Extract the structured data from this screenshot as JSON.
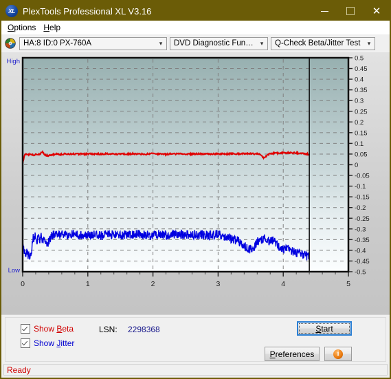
{
  "window": {
    "title": "PlexTools Professional XL V3.16",
    "app_icon": "xl-disc-icon",
    "minimize_label": "",
    "maximize_label": "",
    "close_label": "✕"
  },
  "menubar": {
    "items": [
      {
        "mnemonic": "O",
        "rest": "ptions"
      },
      {
        "mnemonic": "H",
        "rest": "elp"
      }
    ]
  },
  "toolbar": {
    "disc_icon": "optical-disc-icon",
    "drive": {
      "value": "HA:8 ID:0  PX-760A",
      "arrow": "⌄"
    },
    "function": {
      "value": "DVD Diagnostic Functions",
      "arrow": "⌄"
    },
    "test": {
      "value": "Q-Check Beta/Jitter Test",
      "arrow": "⌄"
    }
  },
  "chart_data": {
    "type": "line",
    "title": "",
    "xlabel": "",
    "ylabel": "",
    "xlim": [
      0,
      5
    ],
    "ylim": [
      -0.5,
      0.5
    ],
    "grid": true,
    "legend_position": "bottom-left",
    "y_tick_labels": [
      "0.5",
      "0.45",
      "0.4",
      "0.35",
      "0.3",
      "0.25",
      "0.2",
      "0.15",
      "0.1",
      "0.05",
      "0",
      "-0.05",
      "-0.1",
      "-0.15",
      "-0.2",
      "-0.25",
      "-0.3",
      "-0.35",
      "-0.4",
      "-0.45",
      "-0.5"
    ],
    "x_tick_labels": [
      "0",
      "1",
      "2",
      "3",
      "4",
      "5"
    ],
    "axis_end_labels": {
      "top": "High",
      "bottom": "Low"
    },
    "cursor_x": 4.4,
    "data_end_x": 4.4,
    "colors": {
      "beta": "#e00000",
      "jitter": "#0000e0",
      "plot_top": "#9ab2b2",
      "plot_bottom": "#fbfdfd"
    },
    "series": [
      {
        "name": "Beta",
        "color": "#e00000",
        "x": [
          0.0,
          0.03,
          0.06,
          0.09,
          0.12,
          0.15,
          0.18,
          0.21,
          0.24,
          0.27,
          0.3,
          0.33,
          0.36,
          0.39,
          0.42,
          0.45,
          0.48,
          0.51,
          0.54,
          0.57,
          0.6,
          0.65,
          0.7,
          0.75,
          0.8,
          0.85,
          0.9,
          0.95,
          1.0,
          1.1,
          1.2,
          1.3,
          1.4,
          1.5,
          1.6,
          1.7,
          1.8,
          1.9,
          2.0,
          2.1,
          2.2,
          2.3,
          2.4,
          2.5,
          2.6,
          2.7,
          2.8,
          2.9,
          3.0,
          3.1,
          3.2,
          3.3,
          3.4,
          3.5,
          3.55,
          3.6,
          3.65,
          3.7,
          3.75,
          3.8,
          3.85,
          3.9,
          3.95,
          4.0,
          4.1,
          4.2,
          4.3,
          4.4
        ],
        "y": [
          0.005,
          0.047,
          0.049,
          0.046,
          0.051,
          0.048,
          0.045,
          0.05,
          0.047,
          0.052,
          0.062,
          0.05,
          0.044,
          0.041,
          0.044,
          0.047,
          0.048,
          0.052,
          0.05,
          0.048,
          0.05,
          0.05,
          0.05,
          0.051,
          0.049,
          0.05,
          0.051,
          0.05,
          0.05,
          0.05,
          0.05,
          0.051,
          0.05,
          0.049,
          0.05,
          0.052,
          0.05,
          0.05,
          0.054,
          0.05,
          0.049,
          0.051,
          0.05,
          0.05,
          0.05,
          0.051,
          0.05,
          0.05,
          0.051,
          0.05,
          0.051,
          0.051,
          0.052,
          0.052,
          0.051,
          0.052,
          0.048,
          0.03,
          0.043,
          0.051,
          0.054,
          0.055,
          0.055,
          0.056,
          0.056,
          0.055,
          0.053,
          0.048
        ]
      },
      {
        "name": "Jitter",
        "color": "#0000e0",
        "x": [
          0.0,
          0.02,
          0.04,
          0.06,
          0.08,
          0.1,
          0.12,
          0.14,
          0.16,
          0.18,
          0.2,
          0.22,
          0.24,
          0.26,
          0.28,
          0.3,
          0.32,
          0.34,
          0.36,
          0.38,
          0.4,
          0.45,
          0.5,
          0.55,
          0.6,
          0.7,
          0.8,
          0.9,
          1.0,
          1.1,
          1.2,
          1.3,
          1.4,
          1.5,
          1.6,
          1.7,
          1.8,
          1.9,
          2.0,
          2.1,
          2.2,
          2.3,
          2.4,
          2.5,
          2.6,
          2.7,
          2.8,
          2.9,
          3.0,
          3.05,
          3.1,
          3.15,
          3.2,
          3.25,
          3.3,
          3.35,
          3.4,
          3.45,
          3.5,
          3.55,
          3.6,
          3.65,
          3.7,
          3.75,
          3.8,
          3.85,
          3.9,
          3.95,
          4.0,
          4.05,
          4.1,
          4.15,
          4.2,
          4.25,
          4.3,
          4.35,
          4.4
        ],
        "y": [
          -0.37,
          -0.4,
          -0.415,
          -0.405,
          -0.425,
          -0.43,
          -0.42,
          -0.4,
          -0.335,
          -0.345,
          -0.33,
          -0.355,
          -0.325,
          -0.355,
          -0.33,
          -0.35,
          -0.345,
          -0.37,
          -0.35,
          -0.375,
          -0.355,
          -0.33,
          -0.325,
          -0.328,
          -0.325,
          -0.328,
          -0.325,
          -0.33,
          -0.325,
          -0.328,
          -0.33,
          -0.325,
          -0.328,
          -0.33,
          -0.325,
          -0.328,
          -0.325,
          -0.33,
          -0.327,
          -0.325,
          -0.328,
          -0.33,
          -0.325,
          -0.328,
          -0.327,
          -0.325,
          -0.328,
          -0.33,
          -0.325,
          -0.33,
          -0.335,
          -0.34,
          -0.345,
          -0.35,
          -0.355,
          -0.365,
          -0.375,
          -0.39,
          -0.395,
          -0.385,
          -0.36,
          -0.35,
          -0.345,
          -0.35,
          -0.355,
          -0.35,
          -0.37,
          -0.39,
          -0.395,
          -0.39,
          -0.4,
          -0.405,
          -0.41,
          -0.415,
          -0.42,
          -0.425,
          -0.43
        ]
      }
    ]
  },
  "controls": {
    "show_beta": {
      "label_pre": "Show ",
      "mnemonic": "B",
      "label_post": "eta",
      "checked": true
    },
    "show_jitter": {
      "label_pre": "Show ",
      "mnemonic": "J",
      "label_post": "itter",
      "checked": true
    },
    "lsn_label": "LSN:",
    "lsn_value": "2298368",
    "start": {
      "pre": "",
      "mnemonic": "S",
      "post": "tart"
    },
    "preferences": {
      "pre": "",
      "mnemonic": "P",
      "post": "references"
    },
    "info": {
      "glyph": "i",
      "name": "info-icon"
    }
  },
  "statusbar": {
    "text": "Ready"
  }
}
